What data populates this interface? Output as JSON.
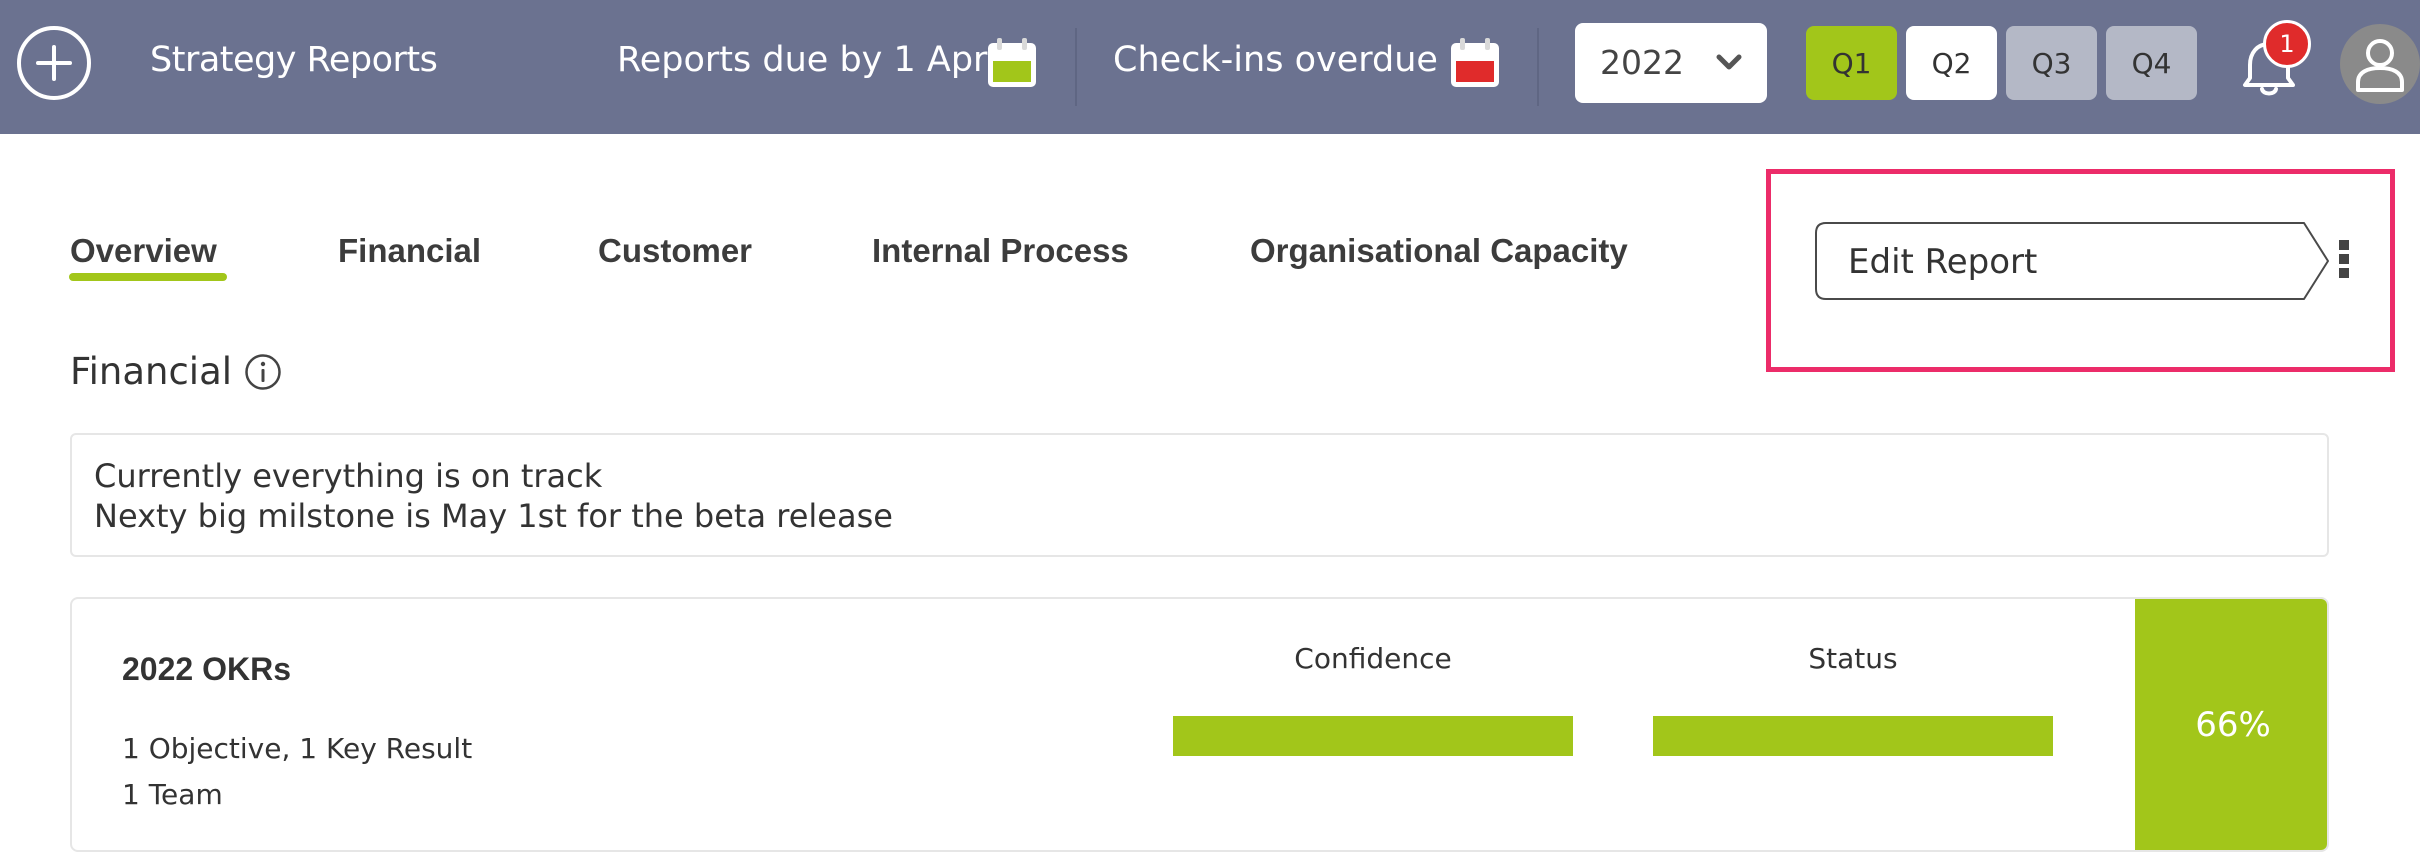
{
  "header": {
    "app_title": "Strategy Reports",
    "reports_due_label": "Reports due by 1 Apr",
    "checkins_overdue_label": "Check-ins overdue",
    "year_select": {
      "value": "2022"
    },
    "quarters": [
      {
        "label": "Q1",
        "state": "selected"
      },
      {
        "label": "Q2",
        "state": "available"
      },
      {
        "label": "Q3",
        "state": "disabled"
      },
      {
        "label": "Q4",
        "state": "disabled"
      }
    ],
    "notifications_count": "1",
    "icons": {
      "add": "plus-circle-icon",
      "reports_due": "calendar-icon",
      "checkins_overdue": "calendar-icon",
      "year_dropdown": "chevron-down-icon",
      "notifications": "bell-icon",
      "avatar": "user-icon"
    }
  },
  "tabs": [
    {
      "label": "Overview",
      "active": true
    },
    {
      "label": "Financial",
      "active": false
    },
    {
      "label": "Customer",
      "active": false
    },
    {
      "label": "Internal Process",
      "active": false
    },
    {
      "label": "Organisational Capacity",
      "active": false
    }
  ],
  "actions": {
    "edit_report_label": "Edit Report",
    "more_icon": "vertical-dots-icon"
  },
  "section": {
    "title": "Financial",
    "info_icon": "info-icon",
    "note_lines": [
      "Currently everything is on track",
      "Nexty big milstone is May 1st for the beta release"
    ]
  },
  "okr_card": {
    "title": "2022 OKRs",
    "objectives_summary": "1 Objective, 1 Key Result",
    "teams_summary": "1 Team",
    "confidence_label": "Confidence",
    "status_label": "Status",
    "confidence_fraction": 1.0,
    "status_fraction": 1.0,
    "percent": "66%"
  },
  "colors": {
    "topbar": "#6b7290",
    "accent_green": "#a2c61a",
    "alert_red": "#e02b2b",
    "highlight_pink": "#ec2c69",
    "quarter_disabled": "#b4b8c6"
  }
}
